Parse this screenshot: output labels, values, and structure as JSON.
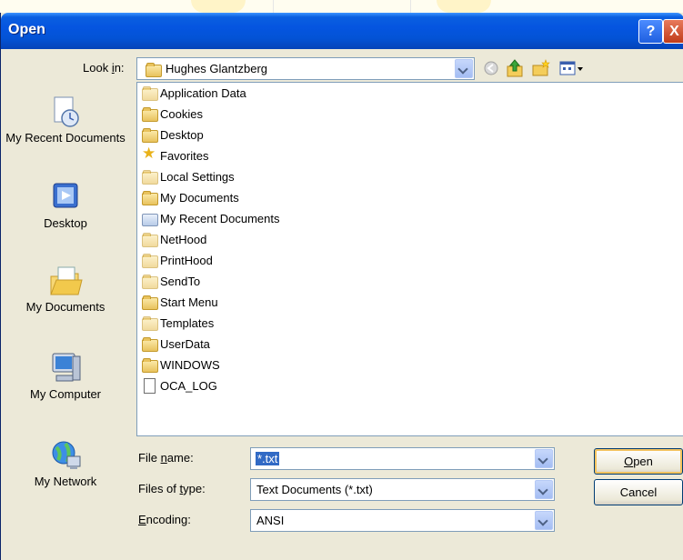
{
  "window": {
    "title": "Open",
    "help_label": "?",
    "close_label": "X"
  },
  "look_in": {
    "label": "Look in:",
    "value": "Hughes Glantzberg"
  },
  "toolbar": {
    "back_icon": "back-arrow-icon",
    "up_icon": "up-folder-icon",
    "new_folder_icon": "new-folder-icon",
    "views_icon": "views-menu-icon"
  },
  "places": [
    {
      "label": "My Recent Documents",
      "icon": "recent-documents-icon"
    },
    {
      "label": "Desktop",
      "icon": "desktop-icon"
    },
    {
      "label": "My Documents",
      "icon": "my-documents-icon"
    },
    {
      "label": "My Computer",
      "icon": "my-computer-icon"
    },
    {
      "label": "My Network",
      "icon": "my-network-icon"
    }
  ],
  "files": [
    {
      "name": "Application Data",
      "icon": "folder-icon"
    },
    {
      "name": "Cookies",
      "icon": "folder-icon"
    },
    {
      "name": "Desktop",
      "icon": "folder-icon"
    },
    {
      "name": "Favorites",
      "icon": "star-icon"
    },
    {
      "name": "Local Settings",
      "icon": "folder-icon"
    },
    {
      "name": "My Documents",
      "icon": "folder-icon"
    },
    {
      "name": "My Recent Documents",
      "icon": "recent-folder-icon"
    },
    {
      "name": "NetHood",
      "icon": "folder-icon"
    },
    {
      "name": "PrintHood",
      "icon": "folder-icon"
    },
    {
      "name": "SendTo",
      "icon": "folder-icon"
    },
    {
      "name": "Start Menu",
      "icon": "folder-icon"
    },
    {
      "name": "Templates",
      "icon": "folder-icon"
    },
    {
      "name": "UserData",
      "icon": "folder-icon"
    },
    {
      "name": "WINDOWS",
      "icon": "folder-icon"
    },
    {
      "name": "OCA_LOG",
      "icon": "text-file-icon"
    }
  ],
  "file_name": {
    "label": "File name:",
    "value": "*.txt"
  },
  "file_type": {
    "label": "Files of type:",
    "value": "Text Documents (*.txt)"
  },
  "encoding": {
    "label": "Encoding:",
    "value": "ANSI"
  },
  "buttons": {
    "open": "Open",
    "cancel": "Cancel"
  },
  "colors": {
    "titlebar": "#0555e0",
    "dialog_bg": "#ece9d8",
    "selection": "#316ac5"
  }
}
